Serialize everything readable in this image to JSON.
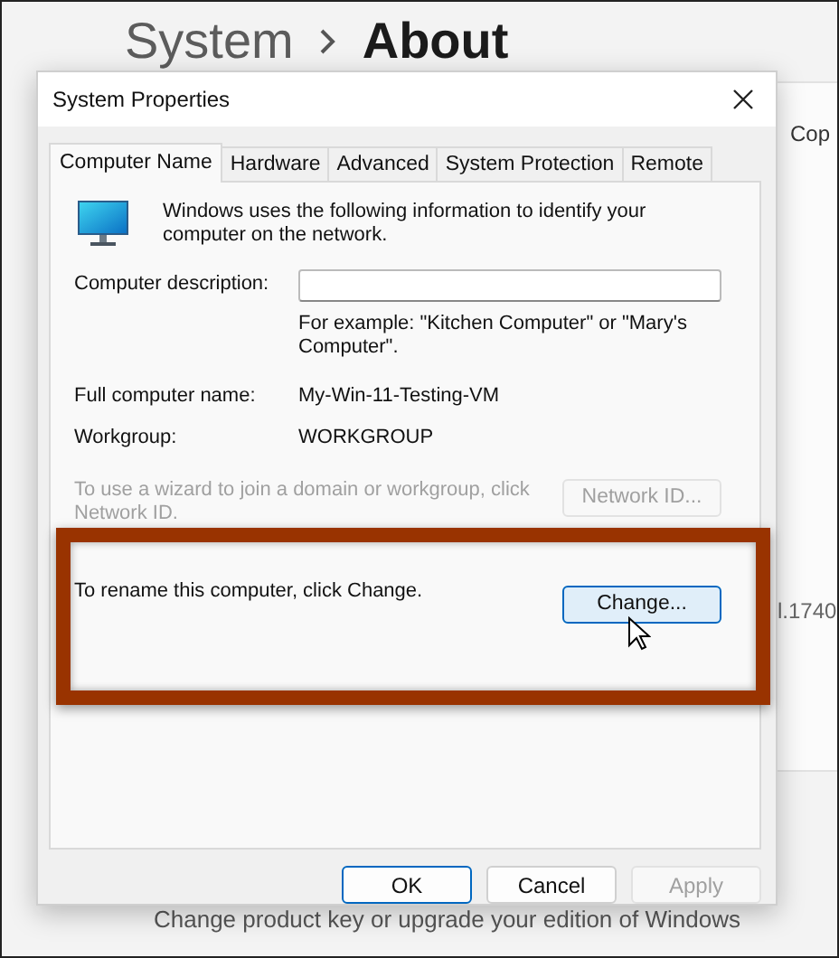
{
  "background": {
    "breadcrumb_parent": "System",
    "breadcrumb_current": "About",
    "side_texts": [
      "Cop",
      "l.1740"
    ],
    "footer_text": "Change product key or upgrade your edition of Windows"
  },
  "dialog": {
    "title": "System Properties",
    "tabs": [
      {
        "label": "Computer Name",
        "selected": true
      },
      {
        "label": "Hardware",
        "selected": false
      },
      {
        "label": "Advanced",
        "selected": false
      },
      {
        "label": "System Protection",
        "selected": false
      },
      {
        "label": "Remote",
        "selected": false
      }
    ],
    "intro": "Windows uses the following information to identify your computer on the network.",
    "description": {
      "label": "Computer description:",
      "hint": "For example: \"Kitchen Computer\" or \"Mary's Computer\"."
    },
    "info_rows": [
      {
        "label": "Full computer name:",
        "value": "My-Win-11-Testing-VM"
      },
      {
        "label": "Workgroup:",
        "value": "WORKGROUP"
      }
    ],
    "network": {
      "text": "To use a wizard to join a domain or workgroup, click Network ID.",
      "button": "Network ID...",
      "disabled": true
    },
    "rename": {
      "text": "To rename this computer, click Change.",
      "button": "Change...",
      "highlighted": true
    },
    "buttons": [
      {
        "label": "OK",
        "default": true,
        "disabled": false
      },
      {
        "label": "Cancel",
        "default": false,
        "disabled": false
      },
      {
        "label": "Apply",
        "default": false,
        "disabled": true
      }
    ]
  }
}
